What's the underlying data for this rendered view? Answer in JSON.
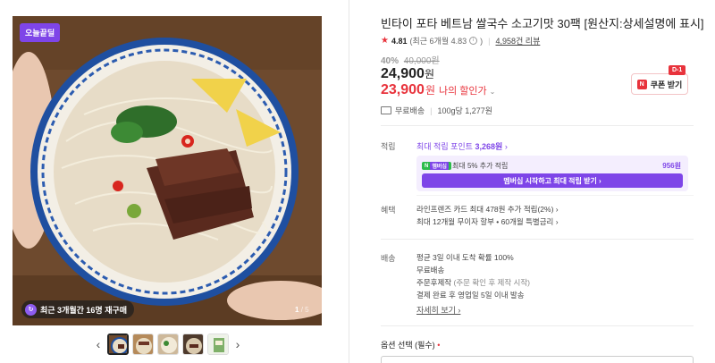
{
  "gallery": {
    "badge_today": "오늘끝딜",
    "restock_text": "최근 3개월간 16명 재구매",
    "page_current": "1",
    "page_total": "/ 5",
    "prev_arrow": "‹",
    "next_arrow": "›"
  },
  "product": {
    "title": "빈타이 포타 베트남 쌀국수 소고기맛 30팩 [원산지:상세설명에 표시]",
    "rating": "4.81",
    "rating_recent": "(최근 6개월 4.83",
    "rating_recent_close": ")",
    "reviews": "4,958건 리뷰",
    "discount_rate": "40%",
    "original_price": "40,000원",
    "price": "24,900",
    "price_unit": "원",
    "my_price": "23,900",
    "my_price_unit": "원",
    "my_price_label": "나의 할인가",
    "coupon_label": "쿠폰 받기",
    "coupon_badge": "D-1",
    "coupon_n": "N",
    "shipping_free": "무료배송",
    "unit_price": "100g당 1,277원"
  },
  "points": {
    "label": "적립",
    "max_label": "최대 적립 포인트",
    "max_value": "3,268원",
    "npay": "N",
    "membership_tag": "멤버십",
    "extra_text": "최대 5% 추가 적립",
    "extra_amount": "956원",
    "membership_button": "멤버십 시작하고 최대 적립 받기 ›"
  },
  "benefits": {
    "label": "혜택",
    "line1": "라인프렌즈 카드 최대 478원 추가 적립(2%) ›",
    "line2": "최대 12개월 무이자 할부 • 60개월 특별금리 ›"
  },
  "delivery": {
    "label": "배송",
    "line1": "평균 3일 이내 도착 확률 100%",
    "line2": "무료배송",
    "line3_main": "주문후제작",
    "line3_sub": "(주문 확인 후 제작 시작)",
    "line4": "결제 완료 후 영업일 5일 이내 발송",
    "detail_link": "자세히 보기 ›"
  },
  "options": {
    "label": "옵션 선택 (필수)",
    "required_mark": "•"
  },
  "colors": {
    "accent_purple": "#7e45e8",
    "sale_red": "#e8333c",
    "npay_green": "#2cbc4a"
  }
}
